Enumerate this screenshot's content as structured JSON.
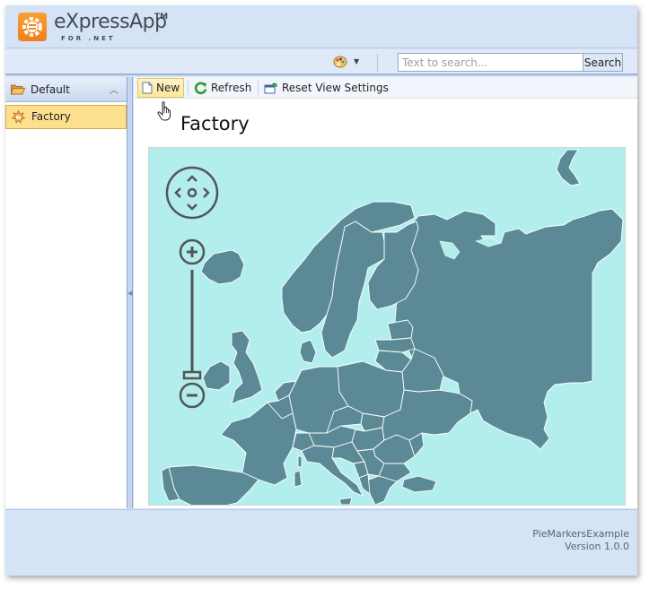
{
  "header": {
    "logo_title": "eXpressApp",
    "logo_tm": "TM",
    "logo_subtitle": "FOR .NET"
  },
  "topbar": {
    "theme_icon": "palette-icon",
    "search": {
      "placeholder": "Text to search...",
      "value": "",
      "button_label": "Search"
    }
  },
  "navigation": {
    "group": {
      "label": "Default",
      "icon": "folder-icon",
      "expanded": true
    },
    "items": [
      {
        "label": "Factory",
        "icon": "factory-icon",
        "selected": true
      }
    ]
  },
  "toolbar": {
    "buttons": [
      {
        "label": "New",
        "icon": "new-document-icon"
      },
      {
        "label": "Refresh",
        "icon": "refresh-icon"
      },
      {
        "label": "Reset View Settings",
        "icon": "reset-view-icon"
      }
    ]
  },
  "view": {
    "title": "Factory",
    "map": {
      "region": "Europe",
      "controls": [
        "pan-control",
        "zoom-in",
        "zoom-slider",
        "zoom-out"
      ],
      "zoom_level_fraction": 0.0,
      "colors": {
        "water": "#b3eeee",
        "land": "#5b8a96",
        "borders": "#ffffff",
        "controls": "#555555"
      }
    }
  },
  "footer": {
    "app_name": "PieMarkersExample",
    "version": "Version 1.0.0"
  }
}
